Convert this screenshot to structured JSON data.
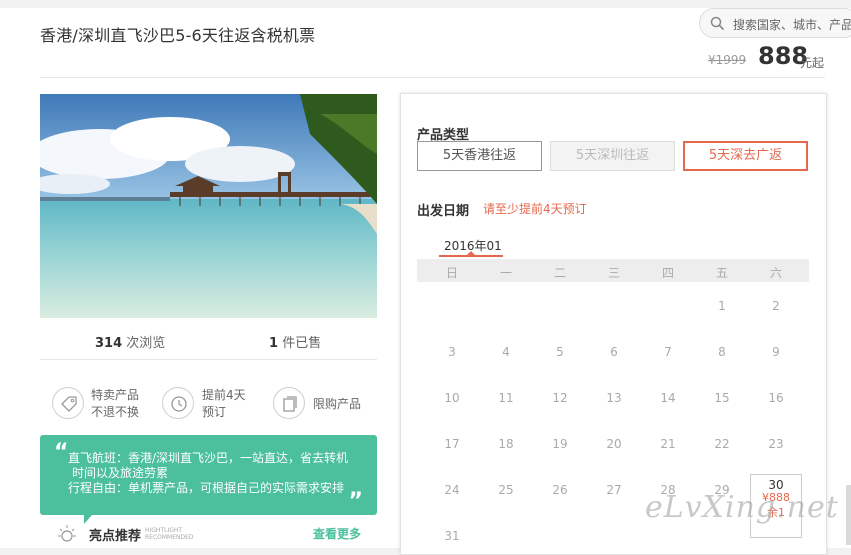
{
  "product": {
    "title": "香港/深圳直飞沙巴5-6天往返含税机票",
    "original_price": "¥1999",
    "price": "888",
    "price_suffix": "元起"
  },
  "search": {
    "placeholder": "搜索国家、城市、产品"
  },
  "stats": {
    "views": "314",
    "views_label": "次浏览",
    "sold": "1",
    "sold_label": "件已售"
  },
  "features": [
    {
      "icon": "tag-icon",
      "line1": "特卖产品",
      "line2": "不退不换"
    },
    {
      "icon": "clock-icon",
      "line1": "提前4天",
      "line2": "预订"
    },
    {
      "icon": "limit-icon",
      "line1": "限购产品",
      "line2": ""
    }
  ],
  "highlight": {
    "lines": [
      "直飞航班：香港/深圳直飞沙巴，一站直达，省去转机",
      "时间以及旅途劳累",
      "行程自由：单机票产品，可根据自己的实际需求安排"
    ],
    "label": "亮点推荐",
    "label_en1": "HIGHTLIGHT",
    "label_en2": "RECOMMENDED",
    "more": "查看更多"
  },
  "booking": {
    "type_title": "产品类型",
    "types": [
      "5天香港往返",
      "5天深圳往返",
      "5天深去广返"
    ],
    "date_title": "出发日期",
    "date_note": "请至少提前4天预订",
    "month": "2016年01",
    "weekdays": [
      "日",
      "一",
      "二",
      "三",
      "四",
      "五",
      "六"
    ],
    "weeks": [
      [
        "",
        "",
        "",
        "",
        "",
        "1",
        "2"
      ],
      [
        "3",
        "4",
        "5",
        "6",
        "7",
        "8",
        "9"
      ],
      [
        "10",
        "11",
        "12",
        "13",
        "14",
        "15",
        "16"
      ],
      [
        "17",
        "18",
        "19",
        "20",
        "21",
        "22",
        "23"
      ],
      [
        "24",
        "25",
        "26",
        "27",
        "28",
        "29",
        ""
      ],
      [
        "31",
        "",
        "",
        "",
        "",
        "",
        ""
      ]
    ],
    "selected_day": {
      "day": "30",
      "price": "¥888",
      "remain": "余1"
    }
  },
  "watermark": "eLvXing.net",
  "colors": {
    "accent": "#e6684f",
    "green": "#4cbf9c"
  }
}
